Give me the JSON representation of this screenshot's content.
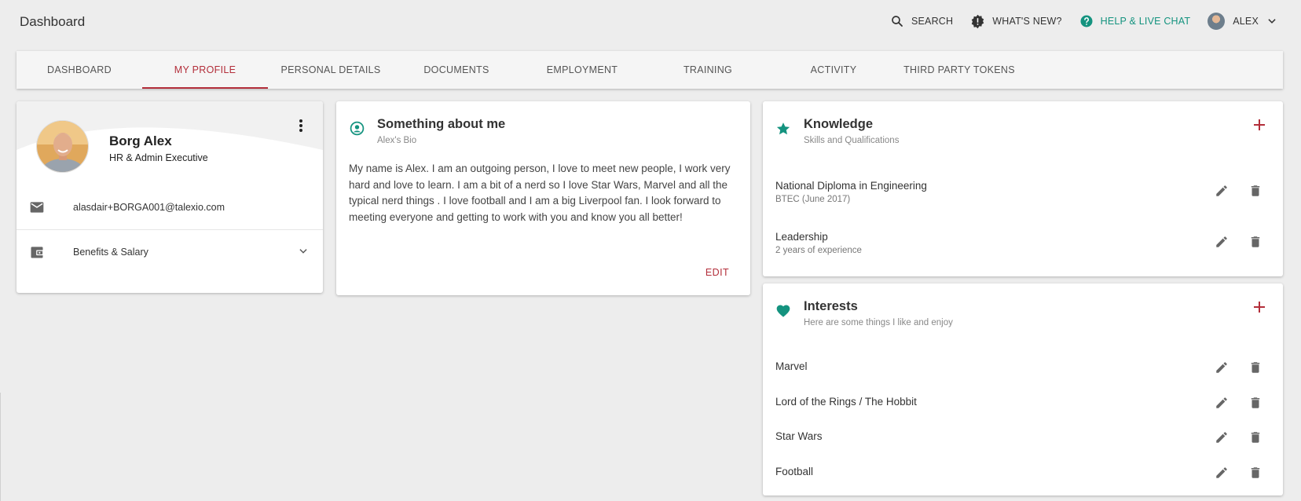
{
  "app": {
    "title": "Dashboard"
  },
  "topbar": {
    "search": "SEARCH",
    "whats_new": "WHAT'S NEW?",
    "help": "HELP & LIVE CHAT",
    "user": "ALEX"
  },
  "tabs": [
    {
      "label": "DASHBOARD"
    },
    {
      "label": "MY PROFILE"
    },
    {
      "label": "PERSONAL DETAILS"
    },
    {
      "label": "DOCUMENTS"
    },
    {
      "label": "EMPLOYMENT"
    },
    {
      "label": "TRAINING"
    },
    {
      "label": "ACTIVITY"
    },
    {
      "label": "THIRD PARTY TOKENS"
    }
  ],
  "active_tab": "MY PROFILE",
  "profile": {
    "name": "Borg Alex",
    "role": "HR & Admin Executive",
    "email": "alasdair+BORGA001@talexio.com",
    "benefits_label": "Benefits & Salary"
  },
  "about": {
    "title": "Something about me",
    "subtitle": "Alex's Bio",
    "bio": "My name is Alex. I am an outgoing person, I love to meet new people, I work very hard and love to learn. I am a bit of a nerd so I love Star Wars, Marvel and all the typical nerd things . I love football and I am a big Liverpool fan. I look forward to meeting everyone and getting to work with you and know you all better!",
    "edit_label": "EDIT"
  },
  "knowledge": {
    "title": "Knowledge",
    "subtitle": "Skills and Qualifications",
    "items": [
      {
        "name": "National Diploma in Engineering",
        "meta": "BTEC (June 2017)"
      },
      {
        "name": "Leadership",
        "meta": "2 years of experience"
      }
    ]
  },
  "interests": {
    "title": "Interests",
    "subtitle": "Here are some things I like and enjoy",
    "items": [
      {
        "name": "Marvel"
      },
      {
        "name": "Lord of the Rings / The Hobbit"
      },
      {
        "name": "Star Wars"
      },
      {
        "name": "Football"
      }
    ]
  },
  "colors": {
    "accent": "#b32e3a",
    "teal": "#14937f",
    "background": "#ededed"
  }
}
